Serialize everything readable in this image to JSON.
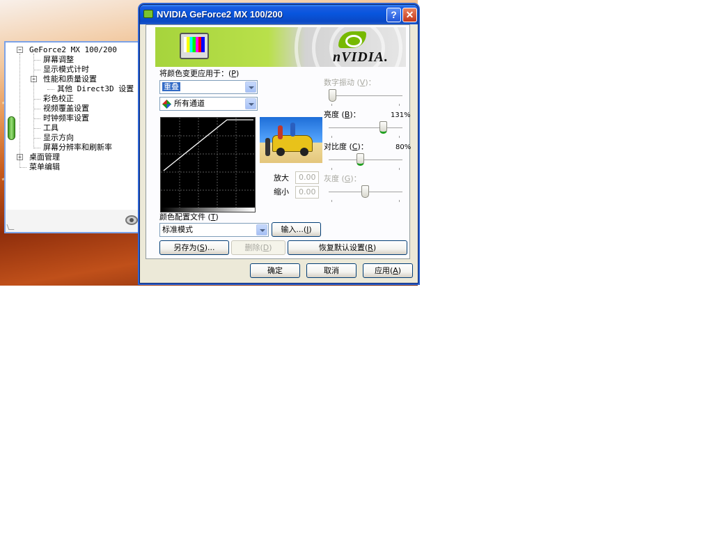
{
  "tree_panel": {
    "items": [
      {
        "label": "GeForce2 MX 100/200",
        "level": 0,
        "expander": "minus"
      },
      {
        "label": "屏幕调整",
        "level": 1
      },
      {
        "label": "显示模式计时",
        "level": 1
      },
      {
        "label": "性能和质量设置",
        "level": 1,
        "expander": "minus"
      },
      {
        "label": "其他 Direct3D 设置",
        "level": 2
      },
      {
        "label": "彩色校正",
        "level": 1
      },
      {
        "label": "视频覆盖设置",
        "level": 1
      },
      {
        "label": "时钟频率设置",
        "level": 1
      },
      {
        "label": "工具",
        "level": 1
      },
      {
        "label": "显示方向",
        "level": 1
      },
      {
        "label": "屏幕分辨率和刷新率",
        "level": 1
      },
      {
        "label": "桌面管理",
        "level": 0,
        "expander": "plus"
      },
      {
        "label": "菜单编辑",
        "level": 0
      }
    ]
  },
  "dialog": {
    "title": "NVIDIA GeForce2 MX 100/200",
    "help_glyph": "?",
    "close_glyph": "✕",
    "banner_brand": "nVIDIA.",
    "apply_to": {
      "label": "将颜色变更应用于：",
      "hotkey": "P",
      "value": "重叠"
    },
    "channel": {
      "value": "所有通道"
    },
    "digital_vibrance": {
      "label": "数字振动",
      "hotkey": "V",
      "value": 0,
      "enabled": false
    },
    "brightness": {
      "label": "亮度",
      "hotkey": "B",
      "display": "131%",
      "value": 131
    },
    "contrast": {
      "label": "对比度",
      "hotkey": "C",
      "display": "80%",
      "value": 80
    },
    "gamma": {
      "label": "灰度",
      "hotkey": "G",
      "value": 1.0,
      "enabled": false
    },
    "zoom_in": {
      "label": "放大",
      "value": "0.00"
    },
    "zoom_out": {
      "label": "缩小",
      "value": "0.00"
    },
    "color_profile": {
      "label": "颜色配置文件",
      "hotkey": "T",
      "value": "标准模式"
    },
    "buttons": {
      "import": {
        "label": "输入...",
        "hotkey": "I"
      },
      "save_as": {
        "label": "另存为",
        "hotkey": "S",
        "suffix": "..."
      },
      "delete": {
        "label": "删除",
        "hotkey": "D"
      },
      "restore": {
        "label": "恢复默认设置",
        "hotkey": "R"
      },
      "ok": {
        "label": "确定"
      },
      "cancel": {
        "label": "取消"
      },
      "apply": {
        "label": "应用",
        "hotkey": "A"
      }
    }
  }
}
